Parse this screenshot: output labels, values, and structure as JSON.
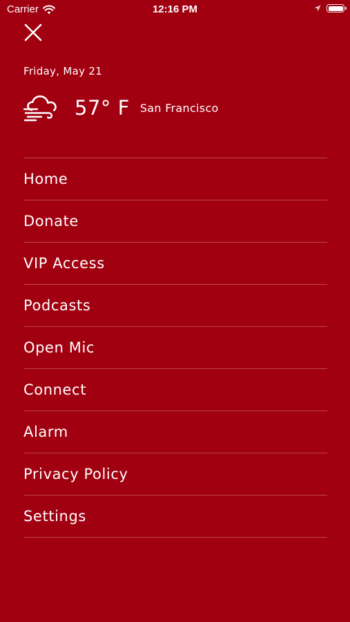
{
  "status_bar": {
    "carrier": "Carrier",
    "time": "12:16 PM",
    "icons": [
      "wifi-icon",
      "location-arrow-icon",
      "battery-icon"
    ]
  },
  "header": {
    "close_icon": "close-icon",
    "date": "Friday, May 21"
  },
  "weather": {
    "icon": "windy-cloud-icon",
    "temperature": "57° F",
    "city": "San Francisco"
  },
  "menu": {
    "items": [
      {
        "label": "Home"
      },
      {
        "label": "Donate"
      },
      {
        "label": "VIP Access"
      },
      {
        "label": "Podcasts"
      },
      {
        "label": "Open Mic"
      },
      {
        "label": "Connect"
      },
      {
        "label": "Alarm"
      },
      {
        "label": "Privacy Policy"
      },
      {
        "label": "Settings"
      }
    ]
  },
  "colors": {
    "background": "#a10010",
    "text": "#ffffff"
  }
}
